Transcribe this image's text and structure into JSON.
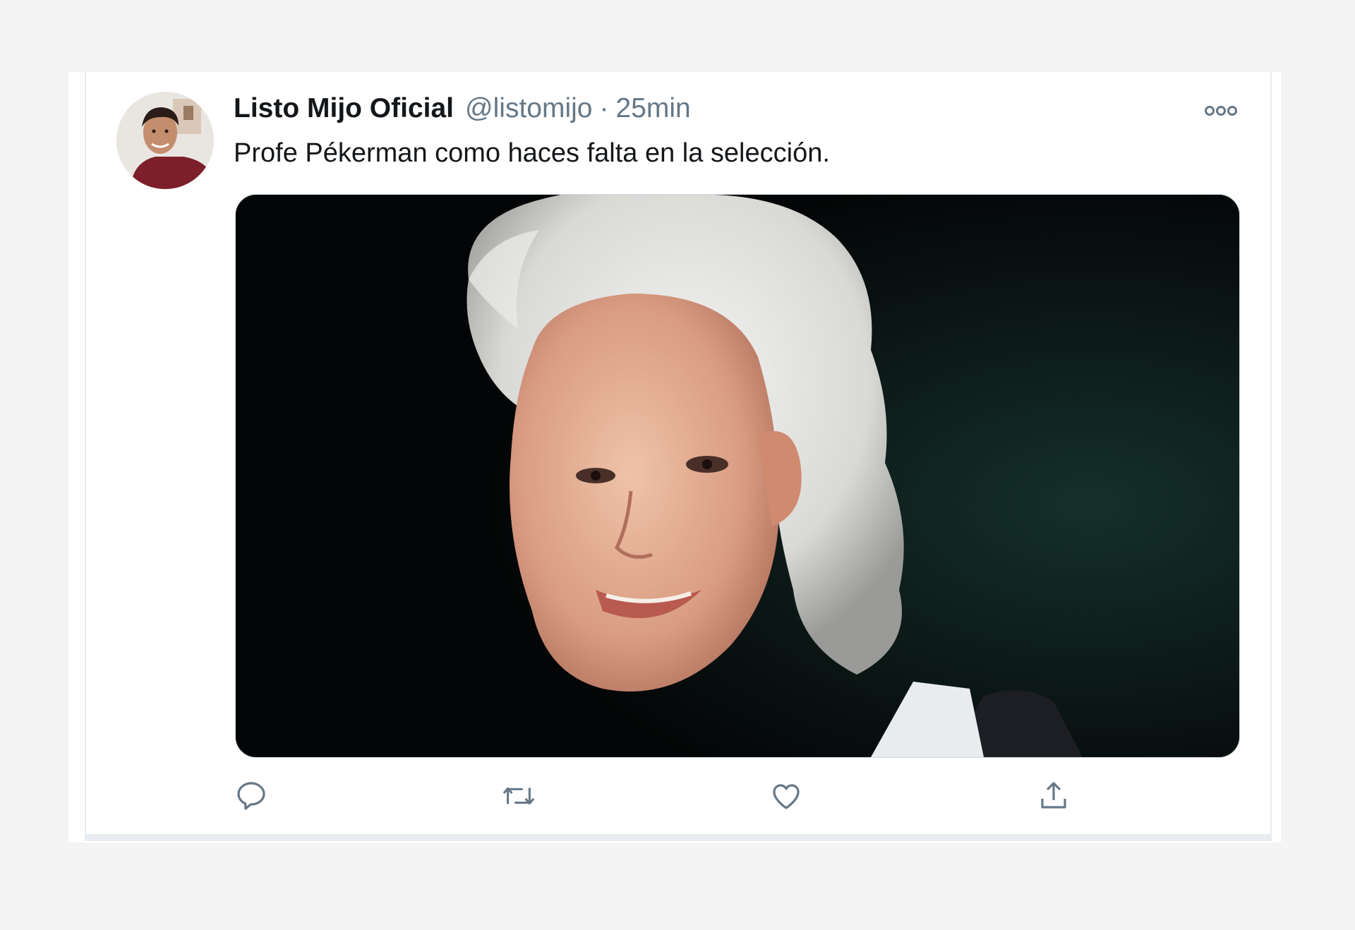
{
  "tweet": {
    "display_name": "Listo Mijo Oficial",
    "handle": "@listomijo",
    "separator": "·",
    "time": "25min",
    "text": "Profe Pékerman como haces falta en la selección."
  },
  "icons": {
    "more": "more-horizontal-icon",
    "reply": "reply-icon",
    "retweet": "retweet-icon",
    "like": "heart-icon",
    "share": "share-icon"
  },
  "colors": {
    "text_primary": "#14171a",
    "text_secondary": "#657786",
    "border": "#e6ecf0",
    "background": "#f4f4f4"
  }
}
